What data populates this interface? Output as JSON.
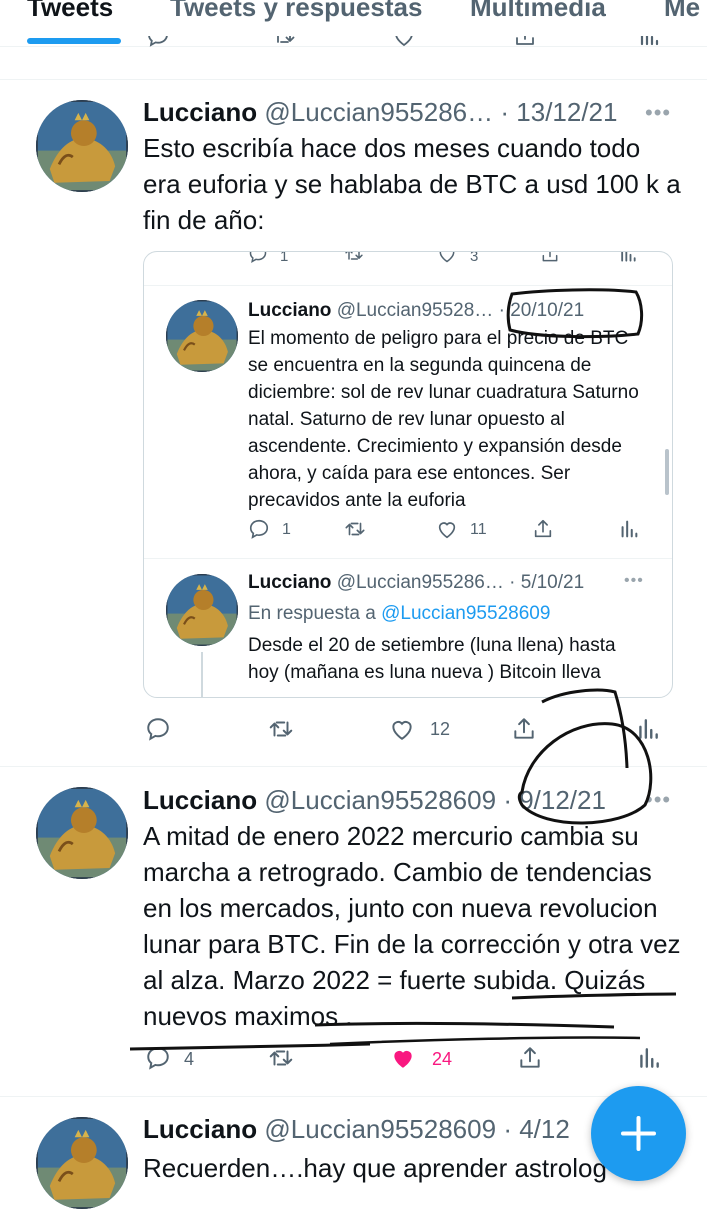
{
  "tabs": [
    {
      "label": "Tweets",
      "active": true
    },
    {
      "label": "Tweets y respuestas"
    },
    {
      "label": "Multimedia"
    },
    {
      "label": "Me"
    }
  ],
  "tweets": [
    {
      "name": "Lucciano",
      "handle": "@Luccian955286…",
      "date": "· 13/12/21",
      "text": "Esto escribía hace dos meses cuando todo era euforia y se hablaba de BTC a usd 100 k a fin de año:",
      "likes": "12",
      "quoted": {
        "top_reply_count": "1",
        "top_like_count": "3",
        "first": {
          "name": "Lucciano",
          "handle": "@Luccian95528…",
          "date": "· 20/10/21",
          "text": "El momento de peligro para el precio de BTC se encuentra en la segunda quincena de diciembre: sol de rev lunar cuadratura Saturno natal. Saturno de rev lunar opuesto al ascendente. Crecimiento y expansión desde ahora, y caída para ese entonces. Ser precavidos ante la euforia",
          "replies": "1",
          "likes": "11"
        },
        "second": {
          "name": "Lucciano",
          "handle": "@Luccian955286…",
          "date": "· 5/10/21",
          "reply_prefix": "En respuesta a",
          "reply_to": "@Luccian95528609",
          "text": "Desde el 20 de setiembre (luna llena) hasta hoy (mañana es luna nueva ) Bitcoin lleva"
        }
      }
    },
    {
      "name": "Lucciano",
      "handle": "@Luccian95528609",
      "date": "· 9/12/21",
      "text": "A mitad de enero 2022 mercurio cambia su marcha a retrogrado. Cambio de tendencias en los mercados, junto con nueva revolucion lunar para BTC. Fin de la corrección y otra vez al alza. Marzo 2022 = fuerte subida. Quizás nuevos maximos .",
      "replies": "4",
      "likes": "24",
      "liked": true
    },
    {
      "name": "Lucciano",
      "handle": "@Luccian95528609",
      "date": "· 4/12",
      "text": "Recuerden….hay que aprender astrolog"
    }
  ],
  "colors": {
    "accent": "#1d9bf0",
    "like_active": "#f91880",
    "secondary_text": "#536471"
  },
  "icons": [
    "reply-icon",
    "retweet-icon",
    "like-icon",
    "share-icon",
    "analytics-icon",
    "more-icon",
    "plus-icon"
  ]
}
